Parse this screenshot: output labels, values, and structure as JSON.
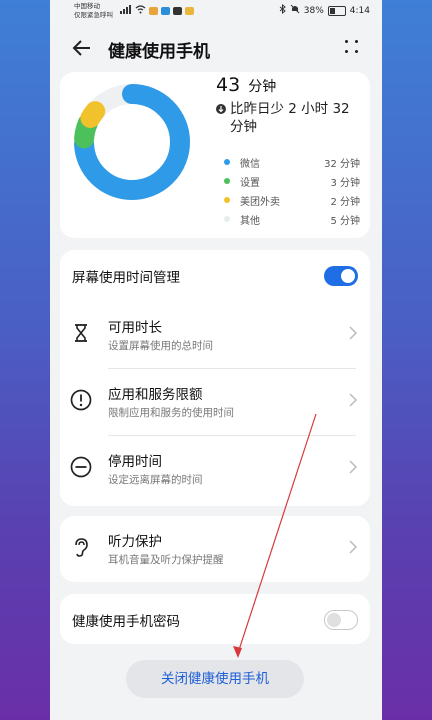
{
  "status_bar": {
    "carrier_line1": "中国移动",
    "carrier_line2": "仅限紧急呼叫",
    "battery": "38%",
    "time": "4:14"
  },
  "header": {
    "title": "健康使用手机"
  },
  "summary": {
    "total_value": "43",
    "total_unit": "分钟",
    "compare_text": "比昨日少 2 小时 32 分钟",
    "legend": [
      {
        "name": "微信",
        "value": "32 分钟",
        "color": "#2f9be8"
      },
      {
        "name": "设置",
        "value": "3 分钟",
        "color": "#4cc05a"
      },
      {
        "name": "美团外卖",
        "value": "2 分钟",
        "color": "#f2c22c"
      },
      {
        "name": "其他",
        "value": "5 分钟",
        "color": "#e9ecef"
      }
    ]
  },
  "management": {
    "title": "屏幕使用时间管理",
    "toggle_on": true,
    "items": [
      {
        "title": "可用时长",
        "subtitle": "设置屏幕使用的总时间"
      },
      {
        "title": "应用和服务限额",
        "subtitle": "限制应用和服务的使用时间"
      },
      {
        "title": "停用时间",
        "subtitle": "设定远离屏幕的时间"
      }
    ]
  },
  "hearing": {
    "title": "听力保护",
    "subtitle": "耳机音量及听力保护提醒"
  },
  "password": {
    "title": "健康使用手机密码",
    "toggle_on": false
  },
  "close_button": "关闭健康使用手机",
  "colors": {
    "accent": "#1f6ee6",
    "annotation_arrow": "#d83a3a"
  }
}
